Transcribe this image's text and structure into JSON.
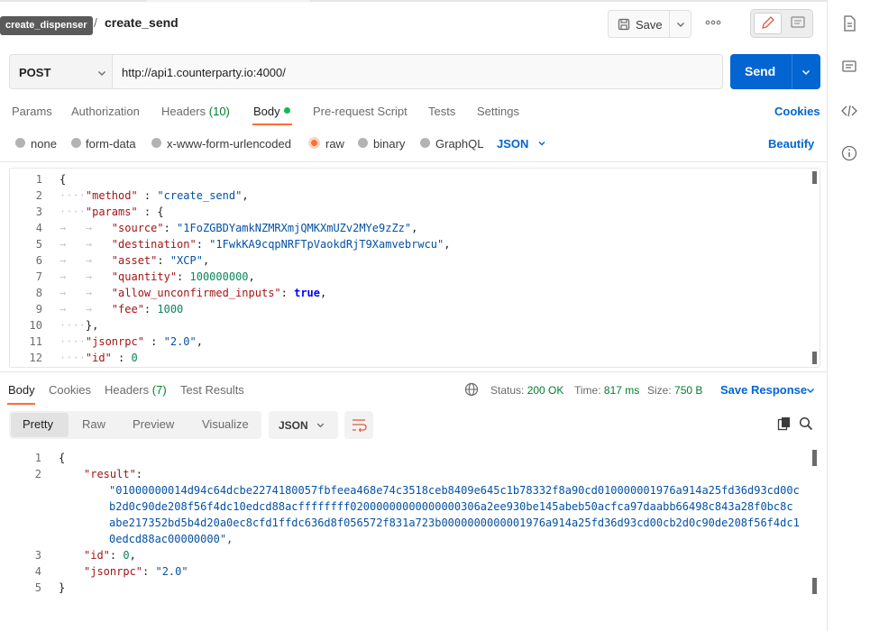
{
  "tooltip": "create_dispenser",
  "breadcrumb": {
    "separator": "/",
    "request_name": "create_send"
  },
  "header": {
    "save_label": "Save",
    "more_label": "ooo"
  },
  "request": {
    "method": "POST",
    "url": "http://api1.counterparty.io:4000/",
    "send_label": "Send"
  },
  "request_tabs": [
    {
      "label": "Params"
    },
    {
      "label": "Authorization"
    },
    {
      "label": "Headers",
      "count": "(10)"
    },
    {
      "label": "Body"
    },
    {
      "label": "Pre-request Script"
    },
    {
      "label": "Tests"
    },
    {
      "label": "Settings"
    }
  ],
  "cookies_label": "Cookies",
  "body_modes": [
    "none",
    "form-data",
    "x-www-form-urlencoded",
    "raw",
    "binary",
    "GraphQL"
  ],
  "selected_body_mode": "raw",
  "body_language": "JSON",
  "beautify_label": "Beautify",
  "request_body": {
    "line_numbers": [
      "1",
      "2",
      "3",
      "4",
      "5",
      "6",
      "7",
      "8",
      "9",
      "10",
      "11",
      "12"
    ],
    "method_key": "\"method\"",
    "method_val": "\"create_send\"",
    "params_key": "\"params\"",
    "source_key": "\"source\"",
    "source_val": "\"1FoZGBDYamkNZMRXmjQMKXmUZv2MYe9zZz\"",
    "destination_key": "\"destination\"",
    "destination_val": "\"1FwkKA9cqpNRFTpVaokdRjT9Xamvebrwcu\"",
    "asset_key": "\"asset\"",
    "asset_val": "\"XCP\"",
    "quantity_key": "\"quantity\"",
    "quantity_val": "100000000",
    "allow_key": "\"allow_unconfirmed_inputs\"",
    "allow_val": "true",
    "fee_key": "\"fee\"",
    "fee_val": "1000",
    "jsonrpc_key": "\"jsonrpc\"",
    "jsonrpc_val": "\"2.0\"",
    "id_key": "\"id\"",
    "id_val": "0"
  },
  "response_tabs": [
    {
      "label": "Body"
    },
    {
      "label": "Cookies"
    },
    {
      "label": "Headers",
      "count": "(7)"
    },
    {
      "label": "Test Results"
    }
  ],
  "response_meta": {
    "status_label": "Status:",
    "status_value": "200 OK",
    "time_label": "Time:",
    "time_value": "817 ms",
    "size_label": "Size:",
    "size_value": "750 B"
  },
  "save_response_label": "Save Response",
  "view_modes": [
    "Pretty",
    "Raw",
    "Preview",
    "Visualize"
  ],
  "response_format": "JSON",
  "response_body": {
    "line_numbers": [
      "1",
      "2",
      "3",
      "4",
      "5"
    ],
    "result_key": "\"result\"",
    "result_lines": [
      "\"01000000014d94c64dcbe2274180057fbfeea468e74c3518ceb8409e645c1b78332f8a90cd010000001976a914a25fd36d93cd00c",
      "b2d0c90de208f56f4dc10edcd88acffffffff02000000000000000306a2ee930be145abeb50acfca97daabb66498c843a28f0bc8c",
      "abe217352bd5b4d20a0ec8cfd1ffdc636d8f056572f831a723b0000000000001976a914a25fd36d93cd00cb2d0c90de208f56f4dc1",
      "0edcd88ac00000000\","
    ],
    "id_key": "\"id\"",
    "id_val": "0",
    "jsonrpc_key": "\"jsonrpc\"",
    "jsonrpc_val": "\"2.0\""
  },
  "colors": {
    "accent_orange": "#ff6c37",
    "primary_blue": "#0265d2",
    "success_green": "#007f31"
  }
}
